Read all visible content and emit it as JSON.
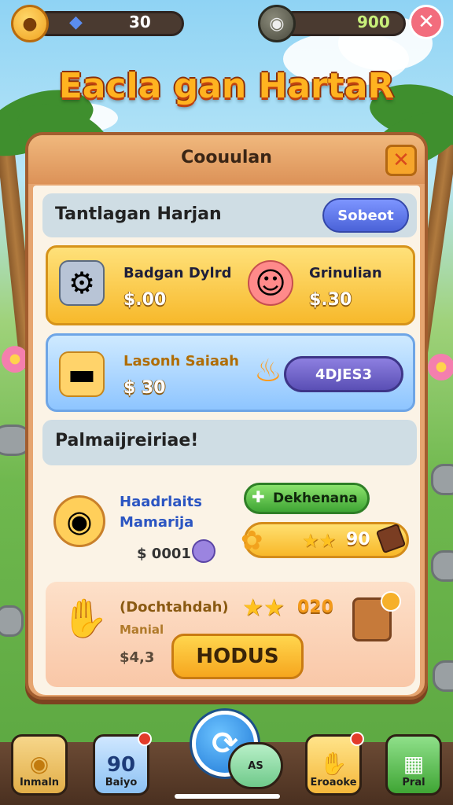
{
  "hud": {
    "left_value": "30",
    "right_value": "900",
    "left_icon": "acorn-coin-icon",
    "left_gem_icon": "blue-gem-icon",
    "right_icon": "bomb-coin-icon",
    "close_icon": "close-icon"
  },
  "title": "Eacla gan HartaR",
  "panel": {
    "title": "Coouulan",
    "close_icon": "close-icon"
  },
  "section1": {
    "title": "Tantlagan Harjan",
    "button": "Sobeot"
  },
  "card1": {
    "item_a_name": "Badgan Dylrd",
    "item_a_price": "$.00",
    "item_b_name": "Grinulian",
    "item_b_price": "$.30"
  },
  "card2": {
    "item_name": "Lasonh Saiaah",
    "item_price": "$ 30",
    "pill_value": "4DJES3"
  },
  "section2": {
    "title": "Palmaijreiriae!"
  },
  "offer1": {
    "name_line1": "Haadrlaits",
    "name_line2": "Mamarija",
    "price": "$ 0001",
    "green_button": "Dekhenana",
    "stars_value": "90"
  },
  "offer2": {
    "name": "(Dochtahdah)",
    "subname": "Manial",
    "price": "$4,3",
    "stars_value": "020",
    "button": "HODUS"
  },
  "bottom_nav": {
    "items": [
      {
        "label": "Inmaln"
      },
      {
        "label": "Baiyo",
        "value": "90"
      },
      {
        "label": "AS"
      },
      {
        "label": "Eroaoke"
      },
      {
        "label": "Pral"
      }
    ]
  },
  "colors": {
    "panel": "#e6a570",
    "accent_blue": "#4a62d8",
    "accent_green": "#3fa534",
    "accent_orange": "#f6a61e"
  }
}
